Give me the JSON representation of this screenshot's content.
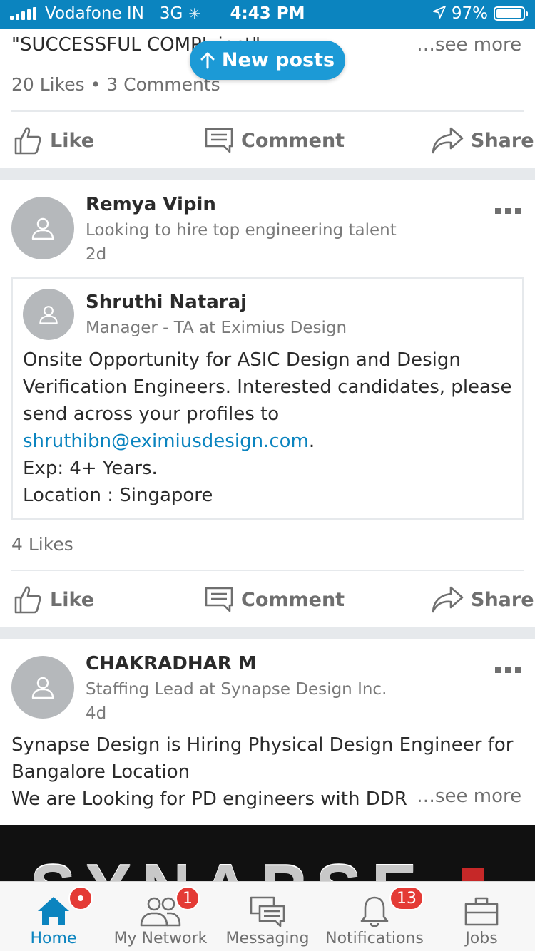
{
  "status_bar": {
    "carrier": "Vodafone IN",
    "network": "3G",
    "time": "4:43 PM",
    "battery": "97%",
    "battery_level": 0.97
  },
  "new_posts_label": "New posts",
  "partial_post": {
    "text_fragment": "\"SUCCESSFUL COMPL                ject\".",
    "see_more": "…see more",
    "counts": "20 Likes • 3 Comments"
  },
  "actions": {
    "like": "Like",
    "comment": "Comment",
    "share": "Share"
  },
  "post1": {
    "author": "Remya Vipin",
    "headline": "Looking to hire top engineering talent",
    "time": "2d",
    "shared": {
      "author": "Shruthi Nataraj",
      "headline": "Manager - TA at Eximius Design",
      "line1": "Onsite Opportunity for ASIC Design and Design",
      "line2": "Verification Engineers. Interested candidates, please",
      "line3": "send across your profiles to",
      "email": "shruthibn@eximiusdesign.com",
      "email_suffix": ".",
      "line5": "Exp: 4+ Years.",
      "line6": "Location : Singapore"
    },
    "counts": "4 Likes"
  },
  "post2": {
    "author": "CHAKRADHAR M",
    "headline": "Staffing Lead at Synapse Design Inc.",
    "time": "4d",
    "line1": "Synapse Design is Hiring Physical Design Engineer for",
    "line2": "Bangalore Location",
    "line3": "We are Looking for PD engineers with DDR H",
    "see_more": "…see more",
    "image_text": "SYNAPSE"
  },
  "tabs": [
    {
      "label": "Home",
      "icon": "home-icon",
      "active": true
    },
    {
      "label": "My Network",
      "icon": "people-icon",
      "badge": "1"
    },
    {
      "label": "Messaging",
      "icon": "messaging-icon"
    },
    {
      "label": "Notifications",
      "icon": "bell-icon",
      "badge": "13"
    },
    {
      "label": "Jobs",
      "icon": "briefcase-icon"
    }
  ],
  "colors": {
    "brand": "#0b84bf",
    "accent_pill": "#1c9ad6",
    "badge": "#e43b36"
  }
}
